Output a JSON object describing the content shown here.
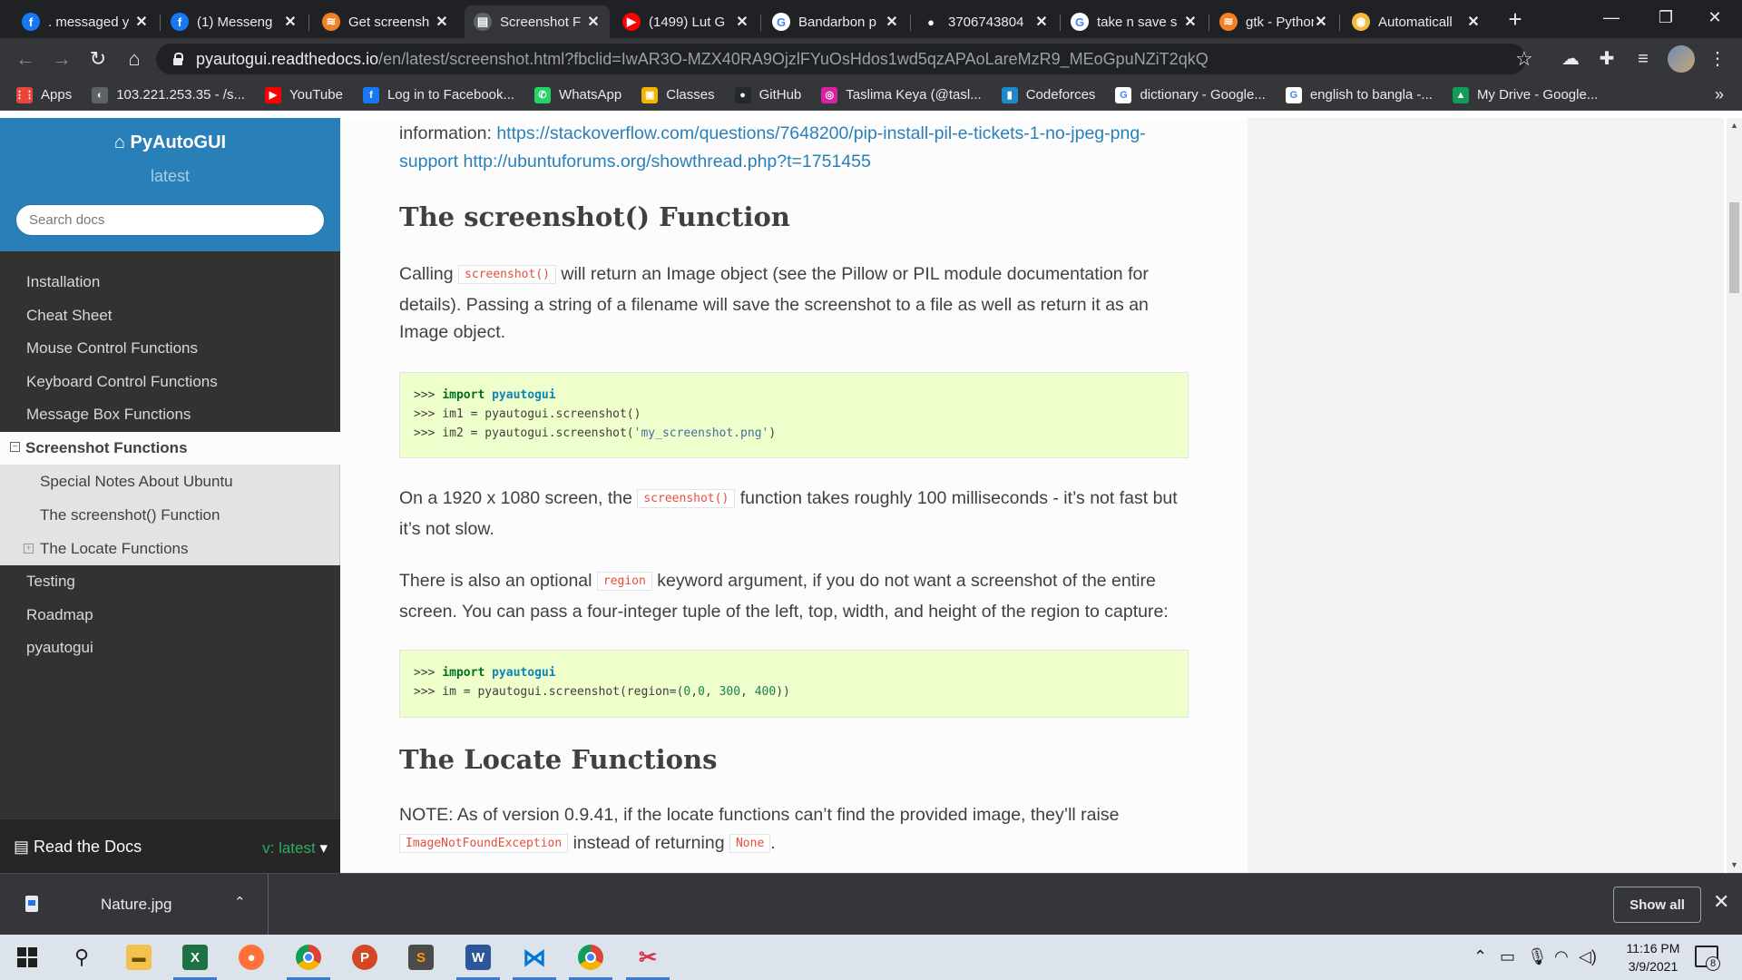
{
  "tabs": [
    {
      "title": ". messaged y",
      "icon": "facebook-icon",
      "color": "#1877f2",
      "glyph": "f"
    },
    {
      "title": "(1) Messeng",
      "icon": "facebook-icon",
      "color": "#1877f2",
      "glyph": "f"
    },
    {
      "title": "Get screensh",
      "icon": "stackoverflow-icon",
      "color": "#f48024",
      "glyph": "≋"
    },
    {
      "title": "Screenshot F",
      "icon": "docs-icon",
      "color": "#5f6368",
      "glyph": "▤"
    },
    {
      "title": "(1499) Lut G",
      "icon": "youtube-icon",
      "color": "#ff0000",
      "glyph": "▶"
    },
    {
      "title": "Bandarbon p",
      "icon": "google-icon",
      "color": "#ffffff",
      "glyph": "G"
    },
    {
      "title": "3706743804",
      "icon": "flickr-icon",
      "color": "#202124",
      "glyph": "●"
    },
    {
      "title": "take n save s",
      "icon": "google-icon",
      "color": "#ffffff",
      "glyph": "G"
    },
    {
      "title": "gtk - Python",
      "icon": "stackoverflow-icon",
      "color": "#f48024",
      "glyph": "≋"
    },
    {
      "title": "Automaticall",
      "icon": "automate-icon",
      "color": "#f5b83d",
      "glyph": "◉"
    }
  ],
  "address": {
    "host": "pyautogui.readthedocs.io",
    "path": "/en/latest/screenshot.html?fbclid=IwAR3O-MZX40RA9OjzlFYuOsHdos1wd5qzAPAoLareMzR9_MEoGpuNZiT2qkQ"
  },
  "bookmarks": [
    {
      "label": "Apps",
      "icon": "apps-grid-icon",
      "color": "#e8453c",
      "glyph": "⋮⋮"
    },
    {
      "label": "103.221.253.35 - /s...",
      "icon": "globe-icon",
      "color": "#5f6368",
      "glyph": "◐"
    },
    {
      "label": "YouTube",
      "icon": "youtube-icon",
      "color": "#ff0000",
      "glyph": "▶"
    },
    {
      "label": "Log in to Facebook...",
      "icon": "facebook-icon",
      "color": "#1877f2",
      "glyph": "f"
    },
    {
      "label": "WhatsApp",
      "icon": "whatsapp-icon",
      "color": "#25d366",
      "glyph": "✆"
    },
    {
      "label": "Classes",
      "icon": "classroom-icon",
      "color": "#f4b400",
      "glyph": "▣"
    },
    {
      "label": "GitHub",
      "icon": "github-icon",
      "color": "#24292e",
      "glyph": "●"
    },
    {
      "label": "Taslima Keya (@tasl...",
      "icon": "instagram-icon",
      "color": "#d6249f",
      "glyph": "◎"
    },
    {
      "label": "Codeforces",
      "icon": "codeforces-icon",
      "color": "#1f8acb",
      "glyph": "▮"
    },
    {
      "label": "dictionary - Google...",
      "icon": "google-icon",
      "color": "#ffffff",
      "glyph": "G"
    },
    {
      "label": "english to bangla -...",
      "icon": "google-icon",
      "color": "#ffffff",
      "glyph": "G"
    },
    {
      "label": "My Drive - Google...",
      "icon": "drive-icon",
      "color": "#0f9d58",
      "glyph": "▲"
    }
  ],
  "sidebar": {
    "title": "PyAutoGUI",
    "version": "latest",
    "search_placeholder": "Search docs",
    "items": [
      {
        "label": "Installation"
      },
      {
        "label": "Cheat Sheet"
      },
      {
        "label": "Mouse Control Functions"
      },
      {
        "label": "Keyboard Control Functions"
      },
      {
        "label": "Message Box Functions"
      },
      {
        "label": "Screenshot Functions"
      },
      {
        "label": "Special Notes About Ubuntu"
      },
      {
        "label": "The screenshot() Function"
      },
      {
        "label": "The Locate Functions"
      },
      {
        "label": "Testing"
      },
      {
        "label": "Roadmap"
      },
      {
        "label": "pyautogui"
      }
    ],
    "footer_name": "Read the Docs",
    "footer_version": "v: latest"
  },
  "content": {
    "top_text": "information: ",
    "top_link1": "https://stackoverflow.com/questions/7648200/pip-install-pil-e-tickets-1-no-jpeg-png-support",
    "top_link2": "http://ubuntuforums.org/showthread.php?t=1751455",
    "h_screenshot": "The screenshot() Function",
    "p1_a": "Calling ",
    "p1_code": "screenshot()",
    "p1_b": " will return an Image object (see the Pillow or PIL module documentation for details). Passing a string of a filename will save the screenshot to a file as well as return it as an Image object.",
    "code1": [
      ">>> import pyautogui",
      ">>> im1 = pyautogui.screenshot()",
      ">>> im2 = pyautogui.screenshot('my_screenshot.png')"
    ],
    "p2_a": "On a 1920 x 1080 screen, the ",
    "p2_code": "screenshot()",
    "p2_b": " function takes roughly 100 milliseconds - it’s not fast but it’s not slow.",
    "p3_a": "There is also an optional ",
    "p3_code": "region",
    "p3_b": " keyword argument, if you do not want a screenshot of the entire screen. You can pass a four-integer tuple of the left, top, width, and height of the region to capture:",
    "code2": [
      ">>> import pyautogui",
      ">>> im = pyautogui.screenshot(region=(0,0, 300, 400))"
    ],
    "h_locate": "The Locate Functions",
    "p4_a": "NOTE: As of version 0.9.41, if the locate functions can’t find the provided image, they’ll raise ",
    "p4_code1": "ImageNotFoundException",
    "p4_b": " instead of returning ",
    "p4_code2": "None",
    "p4_c": "."
  },
  "download": {
    "filename": "Nature.jpg",
    "show_all": "Show all"
  },
  "taskbar": {
    "apps": [
      {
        "icon": "windows-start-icon"
      },
      {
        "icon": "search-icon"
      },
      {
        "icon": "file-explorer-icon"
      },
      {
        "icon": "excel-icon"
      },
      {
        "icon": "firefox-icon"
      },
      {
        "icon": "chrome-icon"
      },
      {
        "icon": "powerpoint-icon"
      },
      {
        "icon": "sublime-text-icon"
      },
      {
        "icon": "word-icon"
      },
      {
        "icon": "vscode-icon"
      },
      {
        "icon": "chrome-icon"
      },
      {
        "icon": "snipping-tool-icon"
      }
    ],
    "time": "11:16 PM",
    "date": "3/9/2021",
    "notifications": "8"
  }
}
